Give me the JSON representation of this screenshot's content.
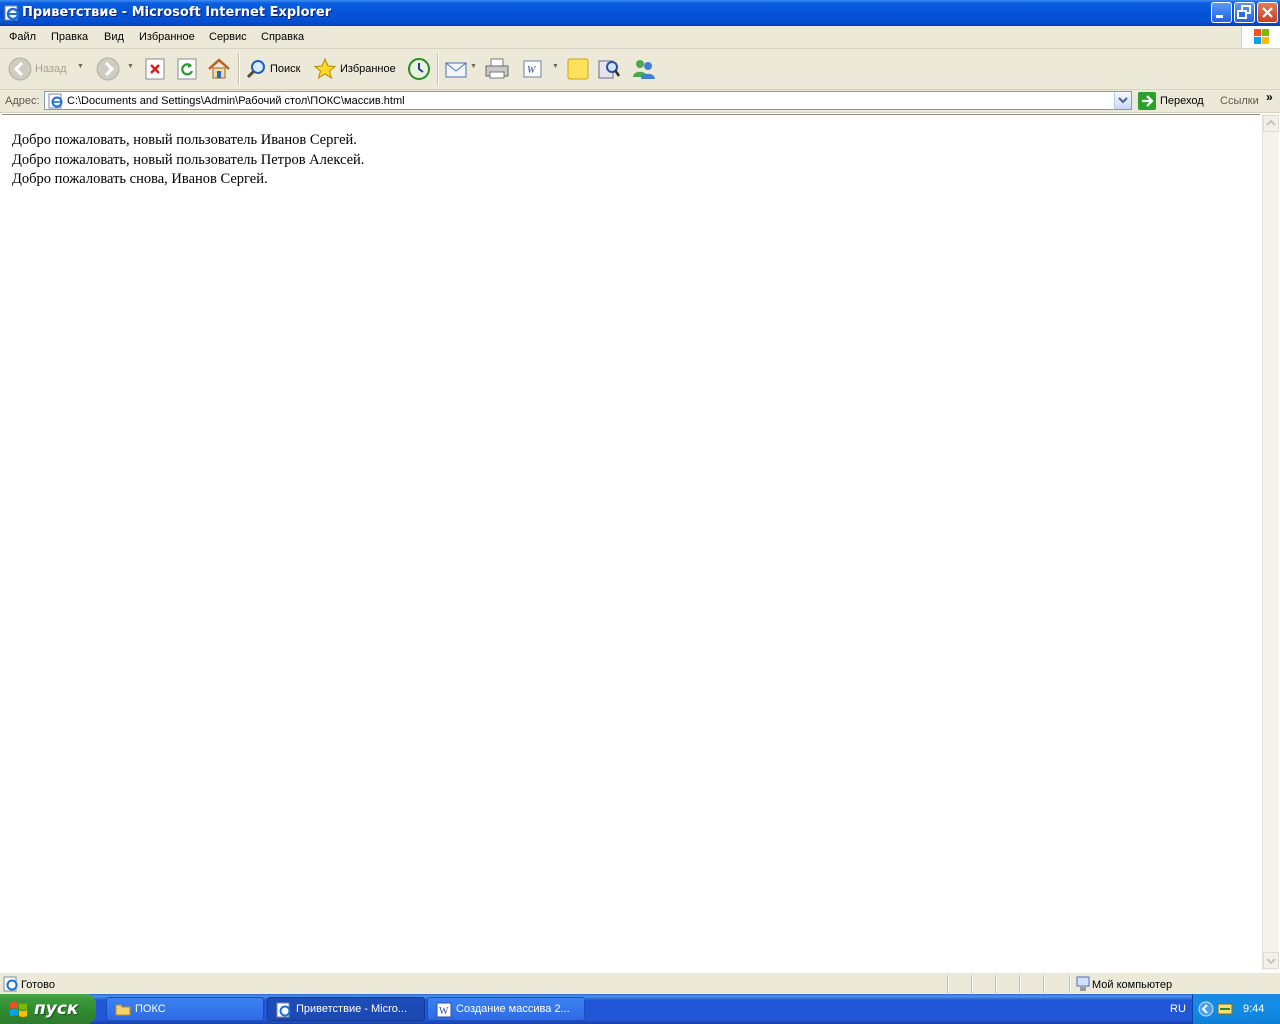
{
  "window": {
    "title": "Приветствие - Microsoft Internet Explorer"
  },
  "menu": [
    "Файл",
    "Правка",
    "Вид",
    "Избранное",
    "Сервис",
    "Справка"
  ],
  "toolbar": {
    "back_label": "Назад",
    "search_label": "Поиск",
    "favorites_label": "Избранное"
  },
  "address": {
    "label": "Адрес:",
    "url": "C:\\Documents and Settings\\Admin\\Рабочий стол\\ПОКС\\массив.html",
    "go_label": "Переход",
    "links_label": "Ссылки"
  },
  "page": {
    "lines": [
      "Добро пожаловать, новый пользователь Иванов Сергей.",
      "Добро пожаловать, новый пользователь Петров Алексей.",
      "Добро пожаловать снова, Иванов Сергей."
    ]
  },
  "status": {
    "text": "Готово",
    "zone": "Мой компьютер"
  },
  "taskbar": {
    "start_label": "пуск",
    "tasks": [
      "ПОКС",
      "Приветствие - Micro...",
      "Создание массива 2..."
    ],
    "language": "RU",
    "clock": "9:44"
  }
}
